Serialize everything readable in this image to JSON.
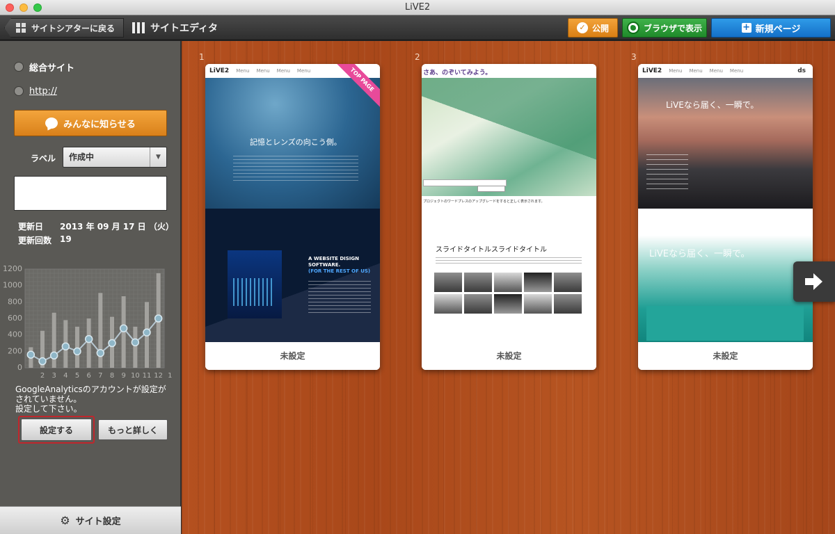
{
  "window": {
    "title": "LiVE2"
  },
  "toolbar": {
    "back_label": "サイトシアターに戻る",
    "editor_label": "サイトエディタ",
    "publish_label": "公開",
    "browser_label": "ブラウザで表示",
    "new_page_label": "新規ページ"
  },
  "sidebar": {
    "site_name": "総合サイト",
    "site_url": "http://",
    "announce_label": "みんなに知らせる",
    "label_caption": "ラベル",
    "label_value": "作成中",
    "updated_caption": "更新日",
    "updated_value": "2013 年 09 月 17 日 （火）",
    "update_count_caption": "更新回数",
    "update_count_value": "19",
    "ga_message_1": "GoogleAnalyticsのアカウントが設定が",
    "ga_message_2": "されていません。",
    "ga_message_3": "設定して下さい。",
    "setup_label": "設定する",
    "more_label": "もっと詳しく",
    "footer_label": "サイト設定"
  },
  "chart_data": {
    "type": "bar",
    "categories": [
      "1",
      "2",
      "3",
      "4",
      "5",
      "6",
      "7",
      "8",
      "9",
      "10",
      "11",
      "12",
      "1"
    ],
    "tick_labels": [
      "2",
      "3",
      "4",
      "5",
      "6",
      "7",
      "8",
      "9",
      "10",
      "11",
      "12",
      "1"
    ],
    "y_ticks": [
      0,
      200,
      400,
      600,
      800,
      1000,
      1200
    ],
    "ylim": [
      0,
      1200
    ],
    "series": [
      {
        "values": [
          250,
          450,
          670,
          580,
          500,
          600,
          910,
          620,
          870,
          500,
          800,
          1150
        ]
      },
      {
        "values": [
          160,
          80,
          150,
          260,
          200,
          350,
          180,
          300,
          480,
          310,
          430,
          600
        ]
      }
    ],
    "grid": true
  },
  "pages": [
    {
      "number": "1",
      "status": "未設定",
      "ribbon": "TOP PAGE",
      "logo": "LiVE2",
      "nav": [
        "Menu",
        "Menu",
        "Menu",
        "Menu"
      ],
      "hero_text": "記憶とレンズの向こう側。",
      "block_title_1": "A WEBSITE DISIGN",
      "block_title_2": "SOFTWARE.",
      "block_title_3": "(FOR THE REST OF US)"
    },
    {
      "number": "2",
      "status": "未設定",
      "header_text": "さあ、のぞいてみよう。",
      "slide_title": "スライドタイトルスライドタイトル",
      "note": "プロジェクトのワードプレスのアップグレードをすると正しく表示されます。"
    },
    {
      "number": "3",
      "status": "未設定",
      "logo": "LiVE2",
      "nav": [
        "Menu",
        "Menu",
        "Menu",
        "Menu"
      ],
      "brand_mark": "ds",
      "hero_text": "LiVEなら届く、一瞬で。",
      "lower_text": "LiVEなら届く、一瞬で。"
    }
  ]
}
